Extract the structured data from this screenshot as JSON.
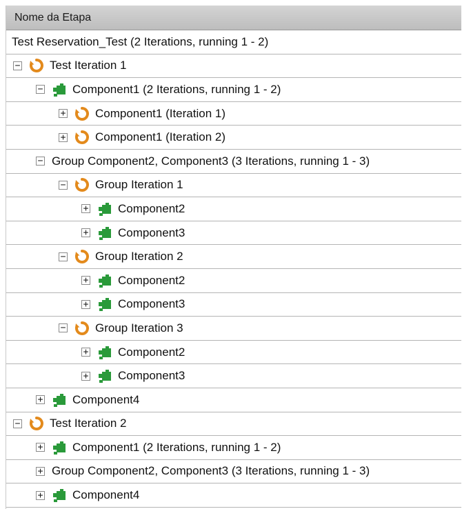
{
  "header": {
    "column_title": "Nome da Etapa"
  },
  "rows": [
    {
      "label": "Test Reservation_Test (2 Iterations, running 1 - 2)",
      "depth": 0,
      "expander": "",
      "icon": ""
    },
    {
      "label": "Test Iteration 1",
      "depth": 0,
      "expander": "−",
      "icon": "iteration-icon"
    },
    {
      "label": "Component1 (2 Iterations, running 1 - 2)",
      "depth": 1,
      "expander": "−",
      "icon": "component-icon"
    },
    {
      "label": "Component1 (Iteration 1)",
      "depth": 2,
      "expander": "+",
      "icon": "iteration-icon"
    },
    {
      "label": "Component1 (Iteration 2)",
      "depth": 2,
      "expander": "+",
      "icon": "iteration-icon"
    },
    {
      "label": "Group Component2, Component3 (3 Iterations, running 1 - 3)",
      "depth": 1,
      "expander": "−",
      "icon": ""
    },
    {
      "label": "Group Iteration 1",
      "depth": 2,
      "expander": "−",
      "icon": "iteration-icon"
    },
    {
      "label": "Component2",
      "depth": 3,
      "expander": "+",
      "icon": "component-icon"
    },
    {
      "label": "Component3",
      "depth": 3,
      "expander": "+",
      "icon": "component-icon"
    },
    {
      "label": "Group Iteration 2",
      "depth": 2,
      "expander": "−",
      "icon": "iteration-icon"
    },
    {
      "label": "Component2",
      "depth": 3,
      "expander": "+",
      "icon": "component-icon"
    },
    {
      "label": "Component3",
      "depth": 3,
      "expander": "+",
      "icon": "component-icon"
    },
    {
      "label": "Group Iteration 3",
      "depth": 2,
      "expander": "−",
      "icon": "iteration-icon"
    },
    {
      "label": "Component2",
      "depth": 3,
      "expander": "+",
      "icon": "component-icon"
    },
    {
      "label": "Component3",
      "depth": 3,
      "expander": "+",
      "icon": "component-icon"
    },
    {
      "label": "Component4",
      "depth": 1,
      "expander": "+",
      "icon": "component-icon"
    },
    {
      "label": "Test Iteration 2",
      "depth": 0,
      "expander": "−",
      "icon": "iteration-icon"
    },
    {
      "label": "Component1 (2 Iterations, running 1 - 2)",
      "depth": 1,
      "expander": "+",
      "icon": "component-icon"
    },
    {
      "label": "Group Component2, Component3 (3 Iterations, running 1 - 3)",
      "depth": 1,
      "expander": "+",
      "icon": ""
    },
    {
      "label": "Component4",
      "depth": 1,
      "expander": "+",
      "icon": "component-icon"
    }
  ],
  "colors": {
    "iteration": "#e38a1c",
    "component": "#2a9a3a",
    "header_bg": "#c6c6c6",
    "row_border": "#b4b4b4"
  }
}
